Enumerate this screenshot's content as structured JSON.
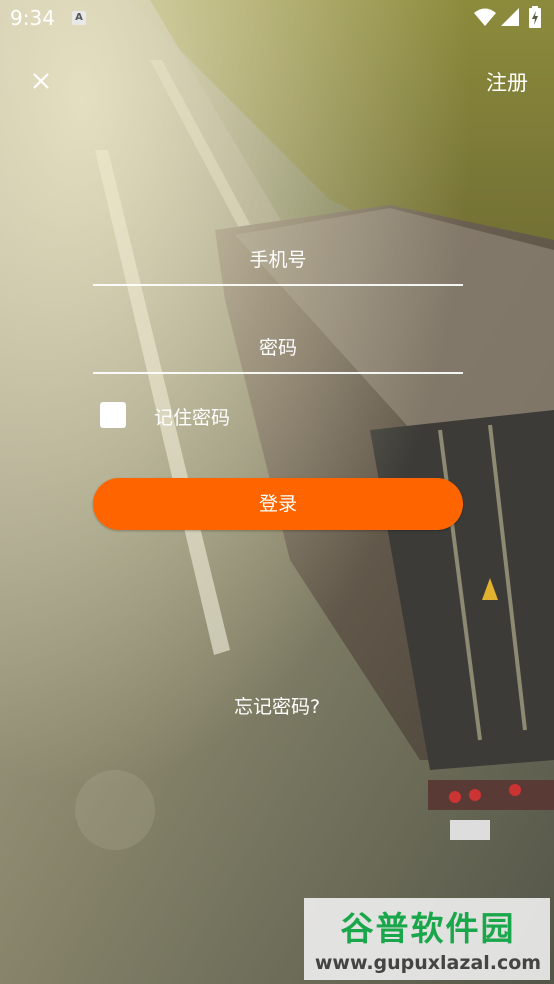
{
  "status_bar": {
    "time": "9:34",
    "notification_icon": "a-icon",
    "icons": [
      "wifi-icon",
      "signal-icon",
      "battery-icon"
    ]
  },
  "header": {
    "close_icon": "close-icon",
    "register_label": "注册"
  },
  "form": {
    "phone_placeholder": "手机号",
    "password_placeholder": "密码",
    "remember_label": "记住密码",
    "remember_checked": false,
    "login_label": "登录",
    "forgot_label": "忘记密码?"
  },
  "watermark": {
    "brand": "谷普软件园",
    "url": "www.gupuxlazal.com"
  },
  "colors": {
    "accent": "#fe6500",
    "watermark_green": "#1aa64a"
  }
}
